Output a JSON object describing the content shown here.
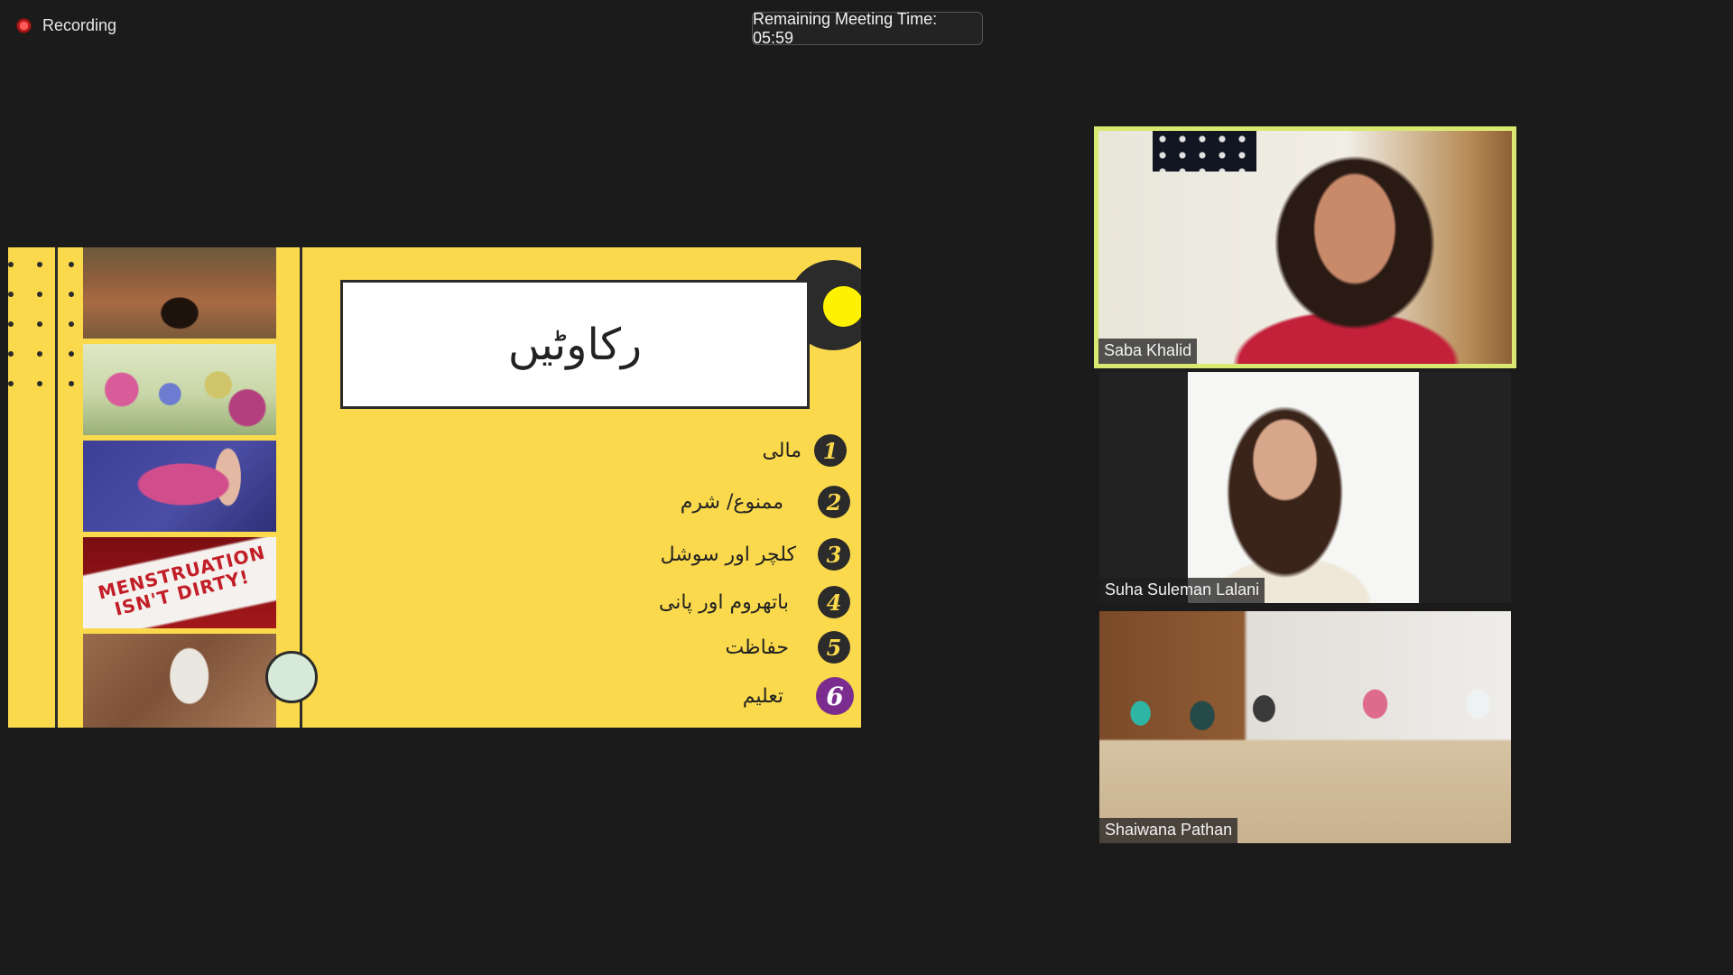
{
  "recording": {
    "label": "Recording"
  },
  "timer": {
    "text": "Remaining Meeting Time: 05:59"
  },
  "slide": {
    "title": "رکاوٹیں",
    "photo_caption": "MENSTRUATION ISN'T DIRTY!",
    "items": [
      {
        "number": "1",
        "text": "مالی"
      },
      {
        "number": "2",
        "text": "ممنوع/ شرم"
      },
      {
        "number": "3",
        "text": "کلچر اور سوشل"
      },
      {
        "number": "4",
        "text": "باتھروم اور پانی"
      },
      {
        "number": "5",
        "text": "حفاظت"
      },
      {
        "number": "6",
        "text": "تعلیم"
      }
    ],
    "accent_color": "#fbd94c",
    "active_item": 6
  },
  "participants": [
    {
      "name": "Saba Khalid",
      "active_speaker": true
    },
    {
      "name": "Suha Suleman Lalani",
      "active_speaker": false
    },
    {
      "name": "Shaiwana Pathan",
      "active_speaker": false
    }
  ]
}
